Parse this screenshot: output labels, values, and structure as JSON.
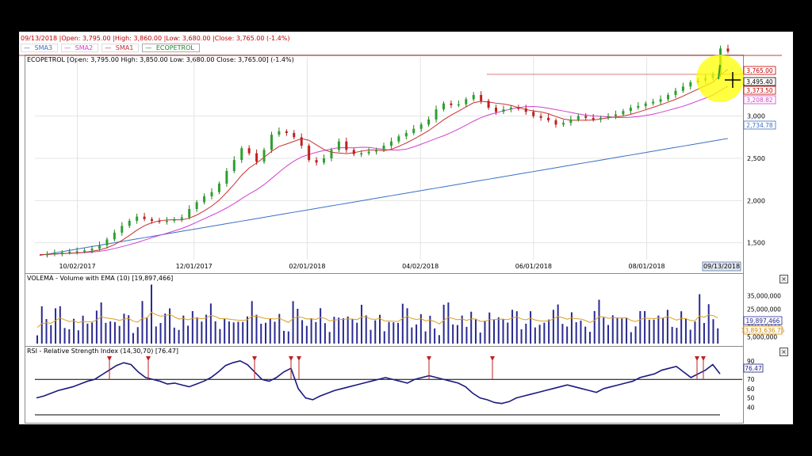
{
  "header": {
    "date": "09/13/2018",
    "open": "Open: 3,795.00",
    "high": "High: 3,860.00",
    "low": "Low: 3,680.00",
    "close": "Close: 3,765.00 (-1.4%)"
  },
  "legend": [
    {
      "label": "SMA3",
      "color": "#3a6fc4"
    },
    {
      "label": "SMA2",
      "color": "#d040d0"
    },
    {
      "label": "SMA1",
      "color": "#c83030"
    },
    {
      "label": "ECOPETROL",
      "color": "#208020"
    }
  ],
  "price_panel": {
    "title": "ECOPETROL [Open: 3,795.00  High: 3,850.00  Low: 3,680.00  Close: 3,765.00] (-1.4%)"
  },
  "volume_panel": {
    "title": "VOLEMA - Volume with EMA (10) [19,897,466]"
  },
  "rsi_panel": {
    "title": "RSI - Relative Strength Index (14,30,70) [76.47]"
  },
  "chart_data": [
    {
      "type": "line",
      "name": "price",
      "x_ticks": [
        "10/02/2017",
        "12/01/2017",
        "02/01/2018",
        "04/02/2018",
        "06/01/2018",
        "08/01/2018"
      ],
      "current_date_label": "09/13/2018",
      "y_ticks": [
        "1,500",
        "2,000",
        "2,500",
        "3,000"
      ],
      "y_tick_values": [
        1500,
        2000,
        2500,
        3000
      ],
      "ylim": [
        1300,
        3700
      ],
      "value_labels": [
        {
          "text": "3,765.00",
          "value": 3765,
          "color": "#c00000"
        },
        {
          "text": "3,495.40",
          "value": 3495,
          "color": "#000000"
        },
        {
          "text": "3,373.50",
          "value": 3373,
          "color": "#c00000"
        },
        {
          "text": "3,208.82",
          "value": 3208,
          "color": "#d040d0"
        },
        {
          "text": "2,734.78",
          "value": 2735,
          "color": "#3a6fc4"
        }
      ],
      "close": [
        1360,
        1365,
        1375,
        1385,
        1395,
        1400,
        1410,
        1430,
        1470,
        1540,
        1620,
        1700,
        1760,
        1810,
        1780,
        1760,
        1750,
        1760,
        1780,
        1800,
        1900,
        1980,
        2050,
        2100,
        2200,
        2350,
        2480,
        2620,
        2560,
        2460,
        2600,
        2780,
        2820,
        2800,
        2750,
        2650,
        2480,
        2450,
        2500,
        2600,
        2700,
        2600,
        2550,
        2560,
        2580,
        2600,
        2650,
        2700,
        2760,
        2800,
        2850,
        2900,
        2960,
        3080,
        3150,
        3130,
        3140,
        3200,
        3250,
        3180,
        3100,
        3050,
        3080,
        3100,
        3090,
        3050,
        3000,
        2980,
        2950,
        2900,
        2920,
        2960,
        3000,
        2980,
        2960,
        2980,
        3000,
        3020,
        3060,
        3100,
        3120,
        3150,
        3170,
        3200,
        3250,
        3300,
        3350,
        3400,
        3420,
        3450,
        3500,
        3800,
        3765
      ]
    },
    {
      "type": "bar",
      "name": "volume",
      "y_ticks": [
        "5,000,000",
        "15,000,000",
        "25,000,000",
        "35,000,000"
      ],
      "y_tick_values": [
        5000000,
        15000000,
        25000000,
        35000000
      ],
      "ylim": [
        0,
        45000000
      ],
      "value_labels": [
        {
          "text": "19,897,466",
          "value": 19897466,
          "color": "#2a2a90"
        },
        {
          "text": "13,893,636.75",
          "value": 13893636,
          "color": "#d08a00"
        }
      ]
    },
    {
      "type": "line",
      "name": "rsi",
      "y_ticks": [
        "40",
        "50",
        "60",
        "70",
        "80",
        "90"
      ],
      "y_tick_values": [
        40,
        50,
        60,
        70,
        80,
        90
      ],
      "ylim": [
        30,
        95
      ],
      "threshold": 70,
      "current_label": "76.47",
      "values": [
        50,
        52,
        55,
        58,
        60,
        62,
        65,
        68,
        70,
        75,
        80,
        85,
        88,
        86,
        78,
        72,
        70,
        68,
        65,
        66,
        64,
        62,
        65,
        68,
        72,
        78,
        85,
        88,
        90,
        86,
        78,
        70,
        68,
        72,
        78,
        82,
        60,
        50,
        48,
        52,
        55,
        58,
        60,
        62,
        64,
        66,
        68,
        70,
        72,
        70,
        68,
        66,
        70,
        72,
        74,
        72,
        70,
        68,
        66,
        62,
        55,
        50,
        48,
        45,
        44,
        46,
        50,
        52,
        54,
        56,
        58,
        60,
        62,
        64,
        62,
        60,
        58,
        56,
        60,
        62,
        64,
        66,
        68,
        72,
        74,
        76,
        80,
        82,
        84,
        78,
        72,
        76,
        80,
        86,
        76
      ]
    }
  ]
}
